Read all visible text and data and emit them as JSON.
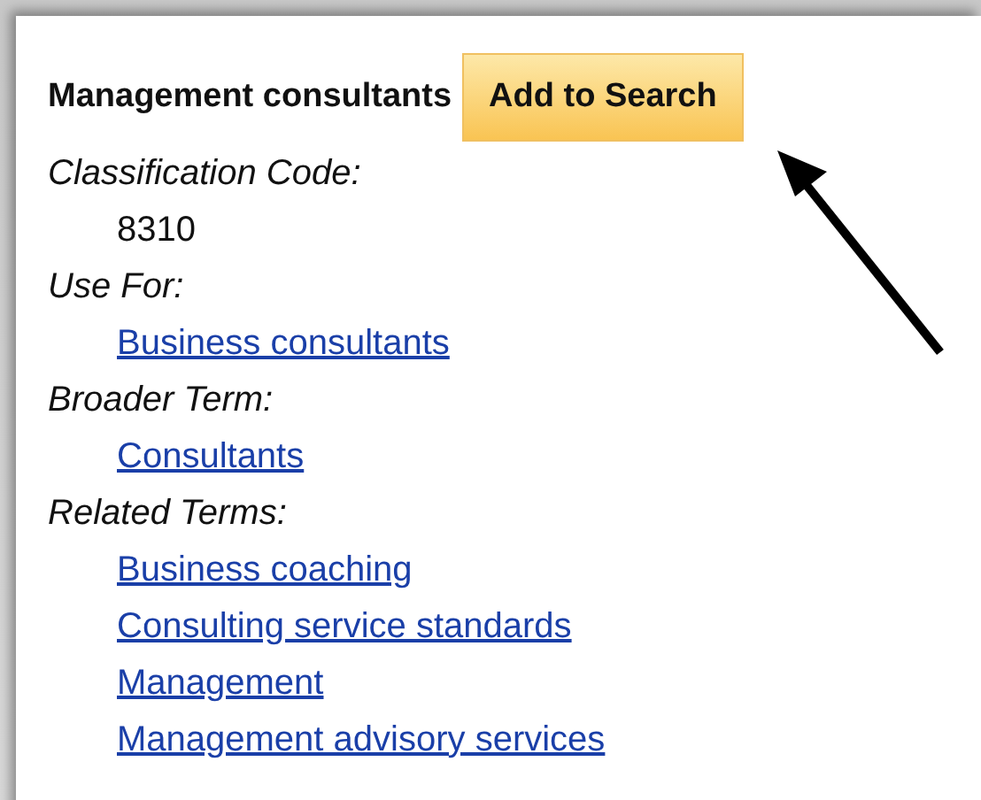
{
  "term": {
    "title": "Management consultants",
    "button": "Add to Search"
  },
  "sections": [
    {
      "label": "Classification Code:",
      "values": [
        {
          "kind": "text",
          "text": "8310"
        }
      ]
    },
    {
      "label": "Use For:",
      "values": [
        {
          "kind": "link",
          "text": "Business consultants"
        }
      ]
    },
    {
      "label": "Broader Term:",
      "values": [
        {
          "kind": "link",
          "text": "Consultants"
        }
      ]
    },
    {
      "label": "Related Terms:",
      "values": [
        {
          "kind": "link",
          "text": "Business coaching"
        },
        {
          "kind": "link",
          "text": "Consulting service standards"
        },
        {
          "kind": "link",
          "text": "Management"
        },
        {
          "kind": "link",
          "text": "Management advisory services"
        }
      ]
    }
  ]
}
